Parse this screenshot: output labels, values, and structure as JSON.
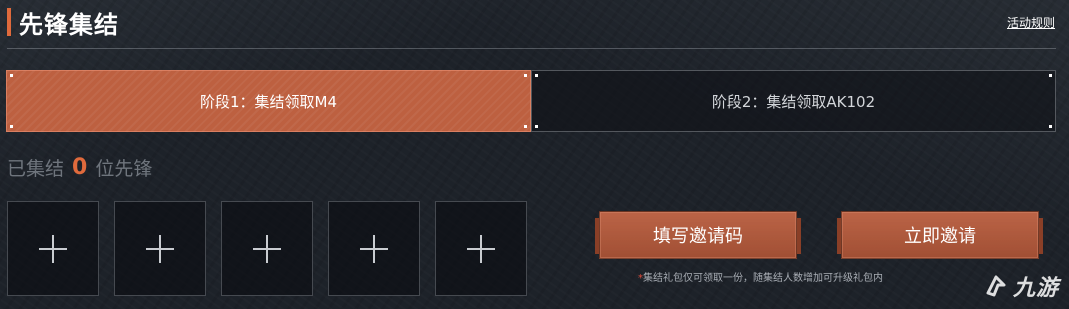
{
  "header": {
    "title": "先锋集结",
    "rules_link": "活动规则"
  },
  "stages": [
    {
      "label": "阶段1：集结领取M4",
      "active": true
    },
    {
      "label": "阶段2：集结领取AK102",
      "active": false
    }
  ],
  "gathered": {
    "prefix": "已集结",
    "count": "0",
    "suffix": "位先锋"
  },
  "slots": [
    {
      "icon": "plus-icon"
    },
    {
      "icon": "plus-icon"
    },
    {
      "icon": "plus-icon"
    },
    {
      "icon": "plus-icon"
    },
    {
      "icon": "plus-icon"
    }
  ],
  "actions": {
    "fill_code_label": "填写邀请码",
    "invite_label": "立即邀请"
  },
  "note": {
    "star": "*",
    "text": "集结礼包仅可领取一份，随集结人数增加可升级礼包内"
  },
  "watermark": {
    "text": "九游"
  },
  "colors": {
    "accent": "#e06a3c",
    "active_tab": "#bd6040",
    "button": "#b75a3b",
    "background": "#1d2229"
  }
}
